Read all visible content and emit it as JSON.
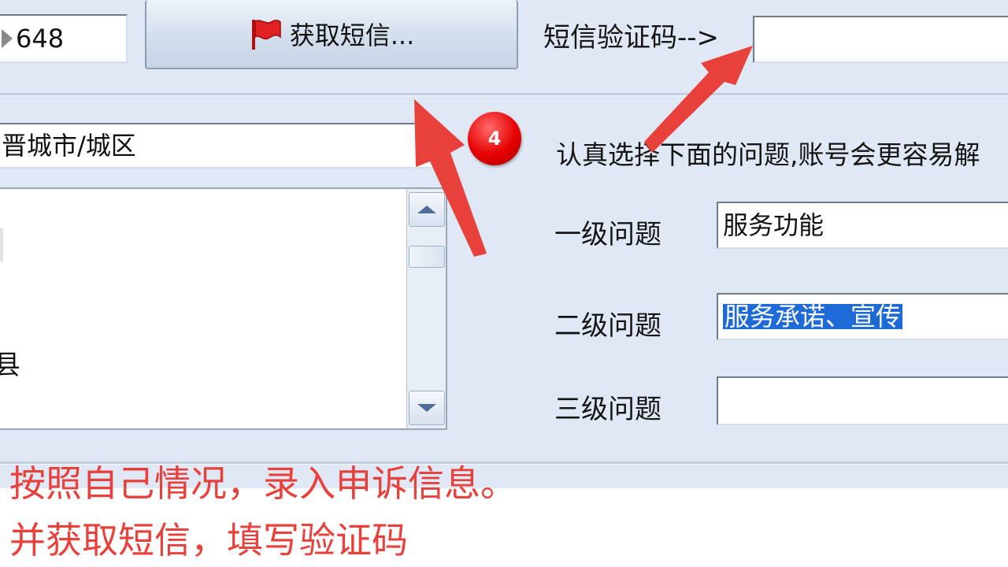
{
  "phone_field": {
    "value": "648"
  },
  "sms_button": {
    "label": "获取短信..."
  },
  "sms_code": {
    "label": "短信验证码-->",
    "value": ""
  },
  "city_field": {
    "value": "晋城市/城区"
  },
  "city_list": {
    "items": [
      "",
      "",
      "",
      "",
      "县",
      ""
    ]
  },
  "step_badge": {
    "number": "4"
  },
  "question_hint": {
    "text": "认真选择下面的问题,账号会更容易解"
  },
  "questions": {
    "level1": {
      "label": "一级问题",
      "value": "服务功能"
    },
    "level2": {
      "label": "二级问题",
      "value": "服务承诺、宣传"
    },
    "level3": {
      "label": "三级问题",
      "value": ""
    }
  },
  "annotation": {
    "line1": "按照自己情况，录入申诉信息。",
    "line2": "并获取短信，填写验证码"
  },
  "colors": {
    "arrow": "#e8413c",
    "badge": "#e60000",
    "selection": "#1e6ad6",
    "annotation": "#e8413c"
  }
}
